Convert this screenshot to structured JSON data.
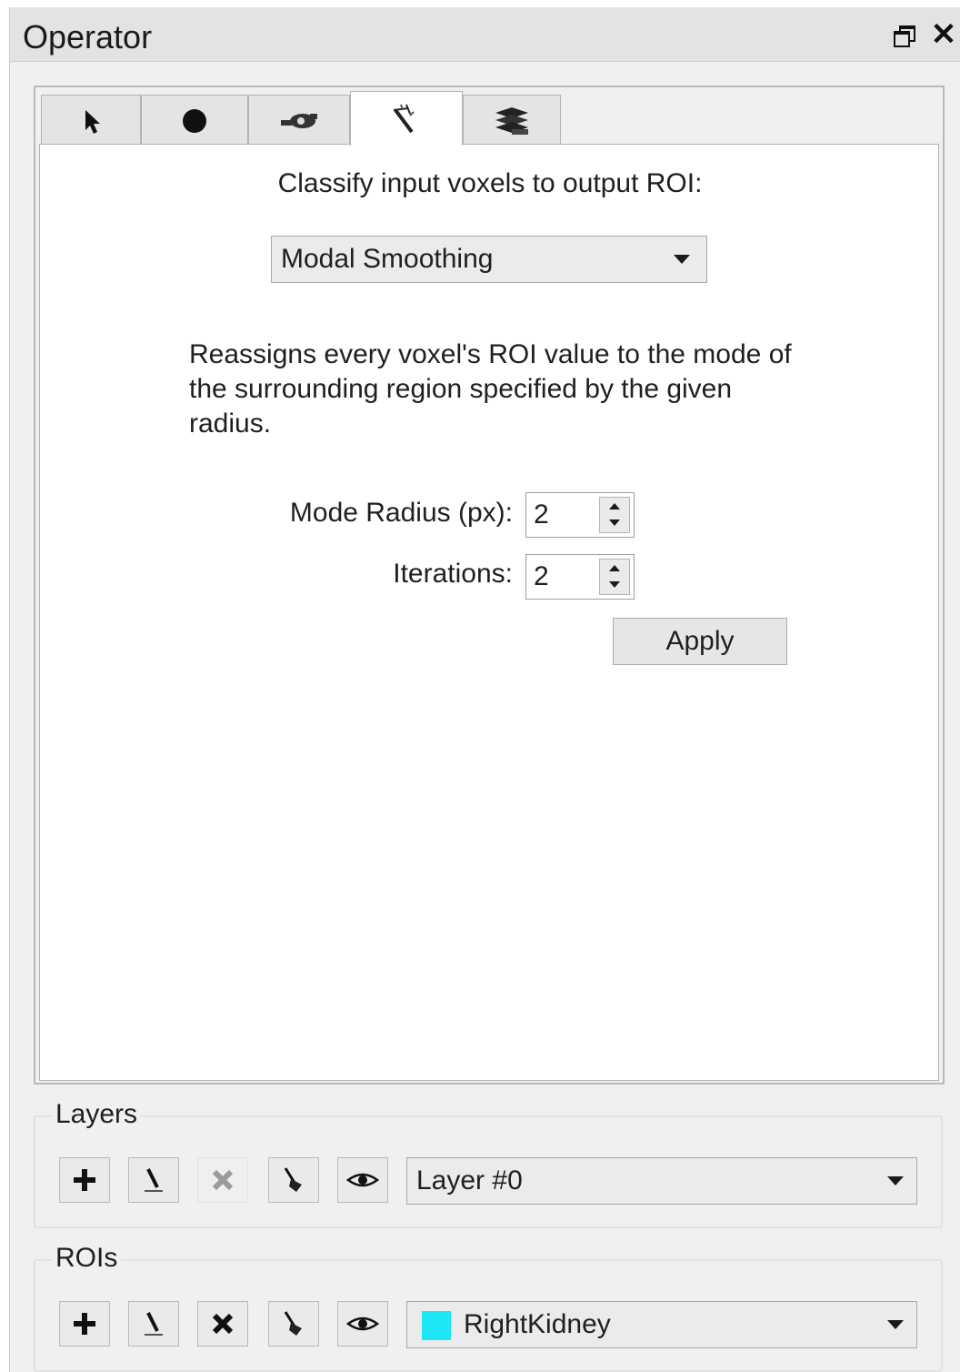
{
  "window": {
    "title": "Operator",
    "controls": [
      "float-icon",
      "close-icon"
    ],
    "close_glyph": "✕"
  },
  "tabs": [
    {
      "icon": "pointer-arrow-icon",
      "active": false
    },
    {
      "icon": "brush-dot-icon",
      "active": false
    },
    {
      "icon": "paint-roller-icon",
      "active": false
    },
    {
      "icon": "wand-icon",
      "active": true
    },
    {
      "icon": "layers-stack-icon",
      "active": false
    }
  ],
  "classify": {
    "heading": "Classify input voxels to output ROI:",
    "method": "Modal Smoothing",
    "description": "Reassigns every voxel's ROI value to the mode of the surrounding region specified by the given radius.",
    "mode_radius_label": "Mode Radius (px):",
    "mode_radius_value": "2",
    "iterations_label": "Iterations:",
    "iterations_value": "2",
    "apply_label": "Apply"
  },
  "layers": {
    "label": "Layers",
    "selected": "Layer #0",
    "buttons": [
      "add-icon",
      "edit-icon",
      "delete-icon",
      "fill-icon",
      "visibility-icon"
    ],
    "delete_enabled": false
  },
  "rois": {
    "label": "ROIs",
    "selected": "RightKidney",
    "selected_color": "#1ee6f5",
    "buttons": [
      "add-icon",
      "edit-icon",
      "delete-icon",
      "fill-icon",
      "visibility-icon"
    ],
    "delete_enabled": true
  }
}
